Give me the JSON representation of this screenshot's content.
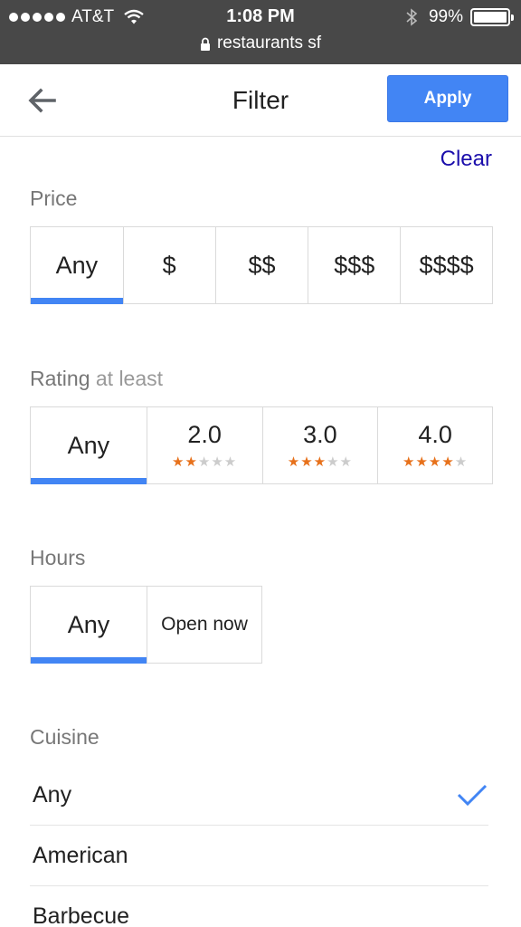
{
  "status_bar": {
    "carrier": "AT&T",
    "time": "1:08 PM",
    "battery": "99%",
    "battery_level": 0.99,
    "url": "restaurants sf"
  },
  "header": {
    "title": "Filter",
    "apply_label": "Apply",
    "back_icon": "arrow-left-icon"
  },
  "clear_label": "Clear",
  "price": {
    "label": "Price",
    "options": [
      "Any",
      "$",
      "$$",
      "$$$",
      "$$$$"
    ],
    "selected": "Any"
  },
  "rating": {
    "label": "Rating",
    "label_suffix": "at least",
    "options": [
      {
        "label": "Any",
        "stars": 0
      },
      {
        "label": "2.0",
        "stars": 2
      },
      {
        "label": "3.0",
        "stars": 3
      },
      {
        "label": "4.0",
        "stars": 4
      }
    ],
    "selected": "Any"
  },
  "hours": {
    "label": "Hours",
    "options": [
      "Any",
      "Open now"
    ],
    "selected": "Any"
  },
  "cuisine": {
    "label": "Cuisine",
    "items": [
      "Any",
      "American",
      "Barbecue"
    ],
    "selected": "Any"
  },
  "colors": {
    "accent": "#4285f4",
    "link": "#1a0dab",
    "star": "#e7711b",
    "status_bar": "#484848"
  }
}
